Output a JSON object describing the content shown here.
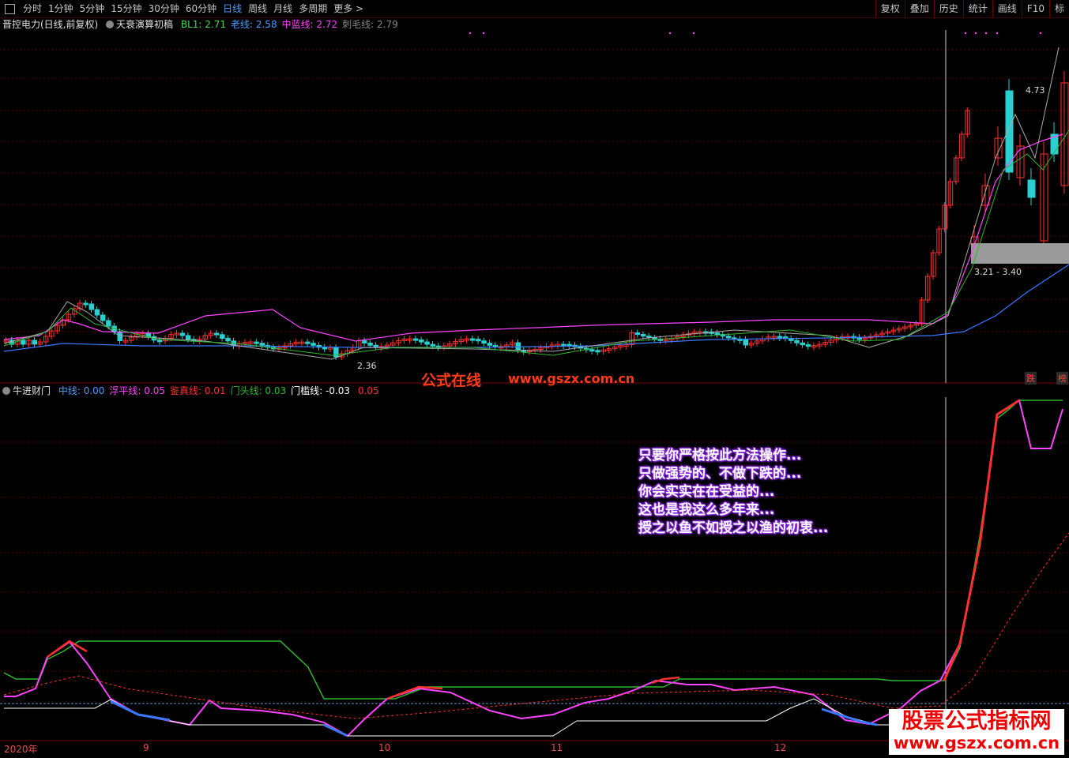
{
  "toolbar": {
    "left_tabs": [
      "分时",
      "1分钟",
      "5分钟",
      "15分钟",
      "30分钟",
      "60分钟",
      "日线",
      "周线",
      "月线",
      "多周期",
      "更多 >"
    ],
    "active_tab": "日线",
    "right_tabs": [
      "复权",
      "叠加",
      "历史",
      "统计",
      "画线",
      "F10",
      "标"
    ]
  },
  "top_legend": {
    "stock": "晋控电力(日线,前复权)",
    "indicator": "天衰演算初稿",
    "items": [
      {
        "label": "BL1:",
        "value": "2.71",
        "color": "#44d84a"
      },
      {
        "label": "老线:",
        "value": "2.58",
        "color": "#4a9cff"
      },
      {
        "label": "中蓝线:",
        "value": "2.72",
        "color": "#ff44ff"
      },
      {
        "label": "刺毛线:",
        "value": "2.79",
        "color": "#888888"
      }
    ]
  },
  "bottom_legend": {
    "name": "牛进财门",
    "items": [
      {
        "label": "中线:",
        "value": "0.00",
        "color": "#4a9cff"
      },
      {
        "label": "浮平线:",
        "value": "0.05",
        "color": "#ff44ff"
      },
      {
        "label": "鉴真线:",
        "value": "0.01",
        "color": "#ff3030"
      },
      {
        "label": "门头线:",
        "value": "0.03",
        "color": "#2eb82e"
      },
      {
        "label": "门槛线:",
        "value": "-0.03",
        "color": "#ffffff"
      },
      {
        "label": "",
        "value": "0.05",
        "color": "#ff3030"
      }
    ]
  },
  "annotations": {
    "low_price": "2.36",
    "high_price": "4.73",
    "range": "3.21 - 3.40",
    "up_icon": "跌",
    "list_icon": "榜"
  },
  "watermark": {
    "name": "公式在线",
    "url": "www.gszx.com.cn"
  },
  "message_lines": [
    "只要你严格按此方法操作...",
    "只做强势的、不做下跌的...",
    "你会实实在在受益的...",
    "这也是我这么多年来...",
    "授之以鱼不如授之以渔的初衷..."
  ],
  "brand": {
    "line1": "股票公式指标网",
    "line2": "www.gszx.com.cn"
  },
  "x_axis_labels": [
    "2020年",
    "9",
    "10",
    "11",
    "12"
  ],
  "colors": {
    "grid": "#5a0000",
    "up": "#ff3030",
    "down": "#2ad0d0",
    "pink": "#ff44ff",
    "green": "#2eb82e",
    "blue": "#3a78ff",
    "white": "#ffffff",
    "gray": "#aaaaaa"
  },
  "chart_data": [
    {
      "type": "candlestick",
      "title": "晋控电力(日线,前复权)",
      "price_labels": {
        "low": 2.36,
        "high": 4.73,
        "zone": [
          3.21,
          3.4
        ]
      },
      "note": "daily candles from Aug 2020 to early Jan 2021, with moving-average overlays"
    },
    {
      "type": "line",
      "title": "牛进财门",
      "series": [
        {
          "name": "中线",
          "value": 0.0
        },
        {
          "name": "浮平线",
          "value": 0.05
        },
        {
          "name": "鉴真线",
          "value": 0.01
        },
        {
          "name": "门头线",
          "value": 0.03
        },
        {
          "name": "门槛线",
          "value": -0.03
        }
      ]
    }
  ]
}
